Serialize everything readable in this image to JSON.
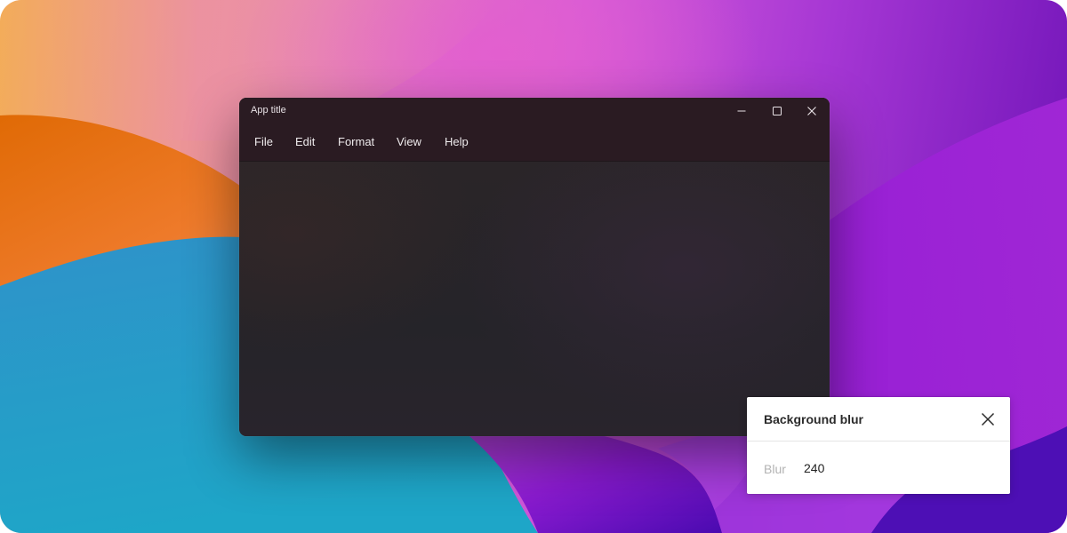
{
  "window": {
    "title": "App title",
    "controls": {
      "minimize_icon": "minimize-icon",
      "maximize_icon": "maximize-icon",
      "close_icon": "close-icon"
    }
  },
  "menu": {
    "items": [
      {
        "label": "File"
      },
      {
        "label": "Edit"
      },
      {
        "label": "Format"
      },
      {
        "label": "View"
      },
      {
        "label": "Help"
      }
    ]
  },
  "blur_panel": {
    "title": "Background blur",
    "close_icon": "close-icon",
    "field_label": "Blur",
    "field_value": "240"
  },
  "colors": {
    "window_chrome": "#2a1b22",
    "window_body": "#27262c",
    "panel_background": "#ffffff",
    "label_muted": "#b3b3b3"
  }
}
